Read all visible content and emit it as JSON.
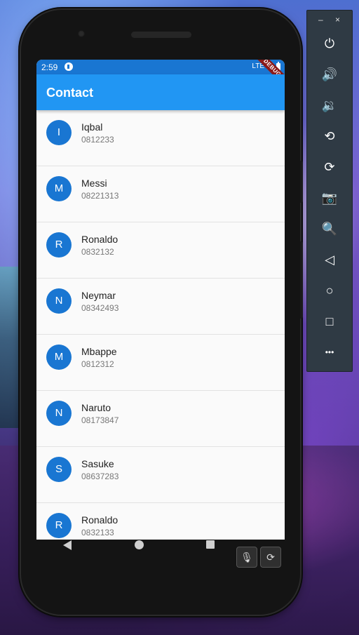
{
  "status_bar": {
    "time": "2:59",
    "network": "LTE"
  },
  "debug_banner": "DEBUG",
  "app_bar": {
    "title": "Contact"
  },
  "contacts": [
    {
      "initial": "I",
      "name": "Iqbal",
      "phone": "0812233"
    },
    {
      "initial": "M",
      "name": "Messi",
      "phone": "08221313"
    },
    {
      "initial": "R",
      "name": "Ronaldo",
      "phone": "0832132"
    },
    {
      "initial": "N",
      "name": "Neymar",
      "phone": "08342493"
    },
    {
      "initial": "M",
      "name": "Mbappe",
      "phone": "0812312"
    },
    {
      "initial": "N",
      "name": "Naruto",
      "phone": "08173847"
    },
    {
      "initial": "S",
      "name": "Sasuke",
      "phone": "08637283"
    },
    {
      "initial": "R",
      "name": "Ronaldo",
      "phone": "0832133"
    }
  ],
  "emulator_toolbar": {
    "minimize": "–",
    "close": "×",
    "buttons": [
      {
        "icon": "power-icon",
        "glyph": "⏻"
      },
      {
        "icon": "volume-up-icon",
        "glyph": "🔊"
      },
      {
        "icon": "volume-down-icon",
        "glyph": "🔉"
      },
      {
        "icon": "rotate-left-icon",
        "glyph": "⟲"
      },
      {
        "icon": "rotate-right-icon",
        "glyph": "⟳"
      },
      {
        "icon": "camera-icon",
        "glyph": "📷"
      },
      {
        "icon": "zoom-icon",
        "glyph": "🔍"
      },
      {
        "icon": "back-icon",
        "glyph": "◁"
      },
      {
        "icon": "home-icon",
        "glyph": "○"
      },
      {
        "icon": "overview-icon",
        "glyph": "□"
      },
      {
        "icon": "more-icon",
        "glyph": "•••"
      }
    ]
  },
  "colors": {
    "app_bar": "#2196f3",
    "status_bar": "#1976d2",
    "avatar": "#1976d2"
  }
}
